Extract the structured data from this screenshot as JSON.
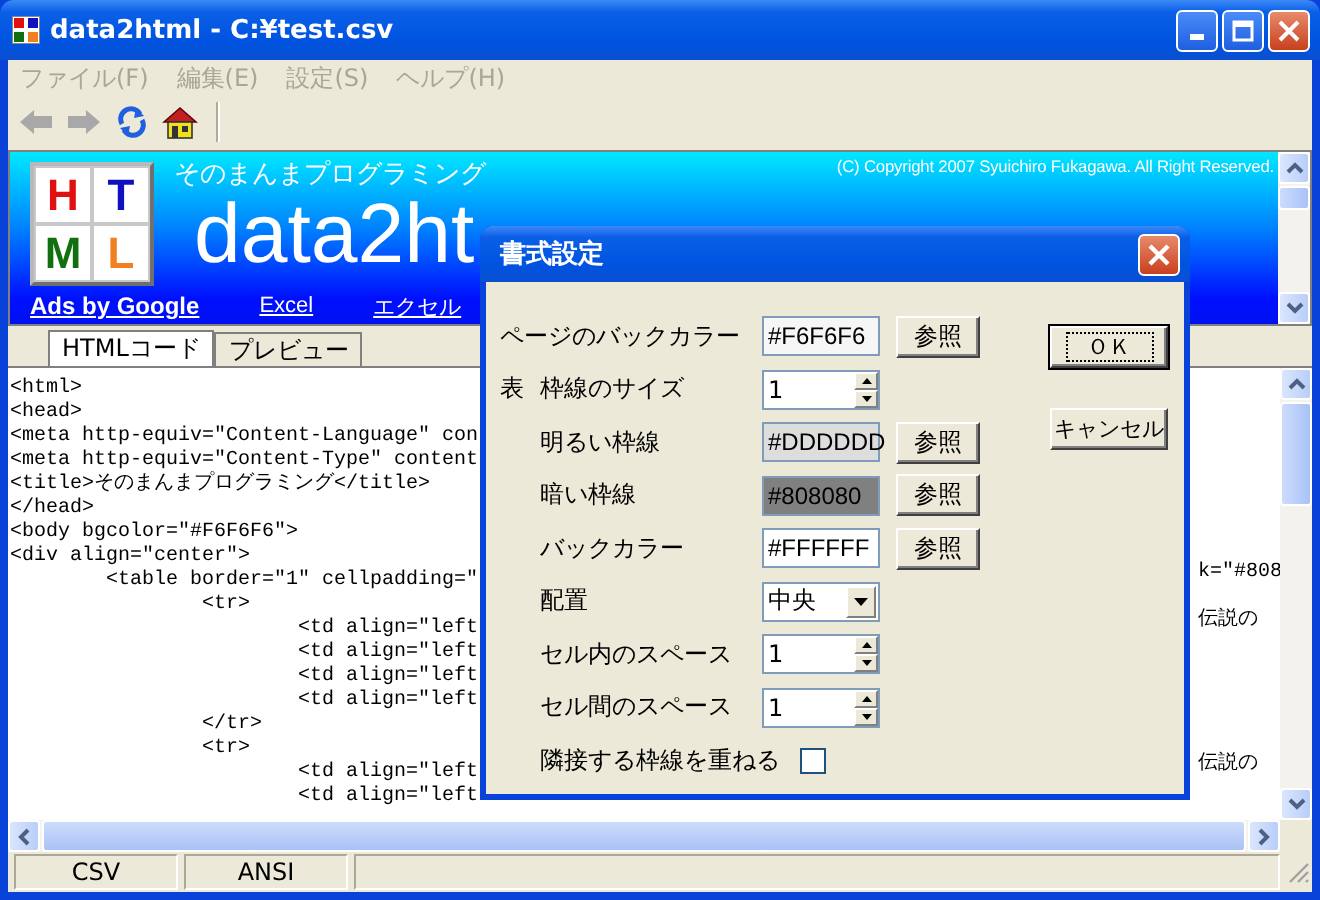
{
  "window": {
    "title": "data2html - C:¥test.csv"
  },
  "menu": [
    {
      "label": "ファイル(F)",
      "disabled": true
    },
    {
      "label": "編集(E)",
      "disabled": true
    },
    {
      "label": "設定(S)",
      "disabled": true
    },
    {
      "label": "ヘルプ(H)",
      "disabled": true
    }
  ],
  "toolbar": [
    {
      "disabled": true
    },
    {
      "disabled": true
    },
    {
      "disabled": false
    },
    {
      "disabled": false
    }
  ],
  "banner": {
    "subtitle": "そのまんまプログラミング",
    "title": "data2ht",
    "copyright": "(C) Copyright 2007 Syuichiro Fukagawa. All Right Reserved.",
    "logo_letters": [
      {
        "letter": "H",
        "color": "#e01010"
      },
      {
        "letter": "T",
        "color": "#1010c0"
      },
      {
        "letter": "M",
        "color": "#107010"
      },
      {
        "letter": "L",
        "color": "#f08020"
      }
    ],
    "links": [
      {
        "label": "Ads by Google",
        "bold": true
      },
      {
        "label": "Excel",
        "bold": false
      },
      {
        "label": "エクセル",
        "bold": false
      }
    ]
  },
  "tabs": [
    {
      "label": "HTMLコード",
      "selected": true
    },
    {
      "label": "プレビュー",
      "selected": false
    }
  ],
  "code": {
    "lines": [
      {
        "text": "<html>"
      },
      {
        "text": "<head>"
      },
      {
        "text": "<meta http-equiv=\"Content-Language\" con"
      },
      {
        "text": "<meta http-equiv=\"Content-Type\" content"
      },
      {
        "text": "<title>そのまんまプログラミング</title>"
      },
      {
        "text": "</head>"
      },
      {
        "text": "<body bgcolor=\"#F6F6F6\">"
      },
      {
        "text": "<div align=\"center\">"
      },
      {
        "text": "        <table border=\"1\" cellpadding=\"",
        "tail": "k=\"#808"
      },
      {
        "text": "                <tr>"
      },
      {
        "text": "                        <td align=\"left",
        "tail": "伝説の"
      },
      {
        "text": "                        <td align=\"left"
      },
      {
        "text": "                        <td align=\"left"
      },
      {
        "text": "                        <td align=\"left"
      },
      {
        "text": "                </tr>"
      },
      {
        "text": "                <tr>"
      },
      {
        "text": "                        <td align=\"left",
        "tail": "伝説の"
      },
      {
        "text": "                        <td align=\"left"
      }
    ]
  },
  "status_bar": [
    "CSV",
    "ANSI"
  ],
  "dialog": {
    "title": "書式設定",
    "page_row": {
      "kind": "color",
      "label": "ページのバックカラー",
      "value": "#F6F6F6",
      "color": "#f6f6f6",
      "button": "参照"
    },
    "table": {
      "label": "表",
      "rows": [
        {
          "kind": "spin",
          "label": "枠線のサイズ",
          "value": "1"
        },
        {
          "kind": "color",
          "label": "明るい枠線",
          "value": "#DDDDDD",
          "color": "#dddddd",
          "button": "参照"
        },
        {
          "kind": "color",
          "label": "暗い枠線",
          "value": "#808080",
          "color": "#808080",
          "button": "参照"
        },
        {
          "kind": "color",
          "label": "バックカラー",
          "value": "#FFFFFF",
          "color": "#ffffff",
          "button": "参照"
        },
        {
          "kind": "select",
          "label": "配置",
          "value": "中央"
        },
        {
          "kind": "spin",
          "label": "セル内のスペース",
          "value": "1"
        },
        {
          "kind": "spin",
          "label": "セル間のスペース",
          "value": "1"
        },
        {
          "kind": "checkbox",
          "label": "隣接する枠線を重ねる",
          "checked": false
        }
      ]
    },
    "buttons": [
      {
        "label": "ＯＫ",
        "focused": true
      },
      {
        "label": "キャンセル",
        "focused": false
      }
    ]
  }
}
